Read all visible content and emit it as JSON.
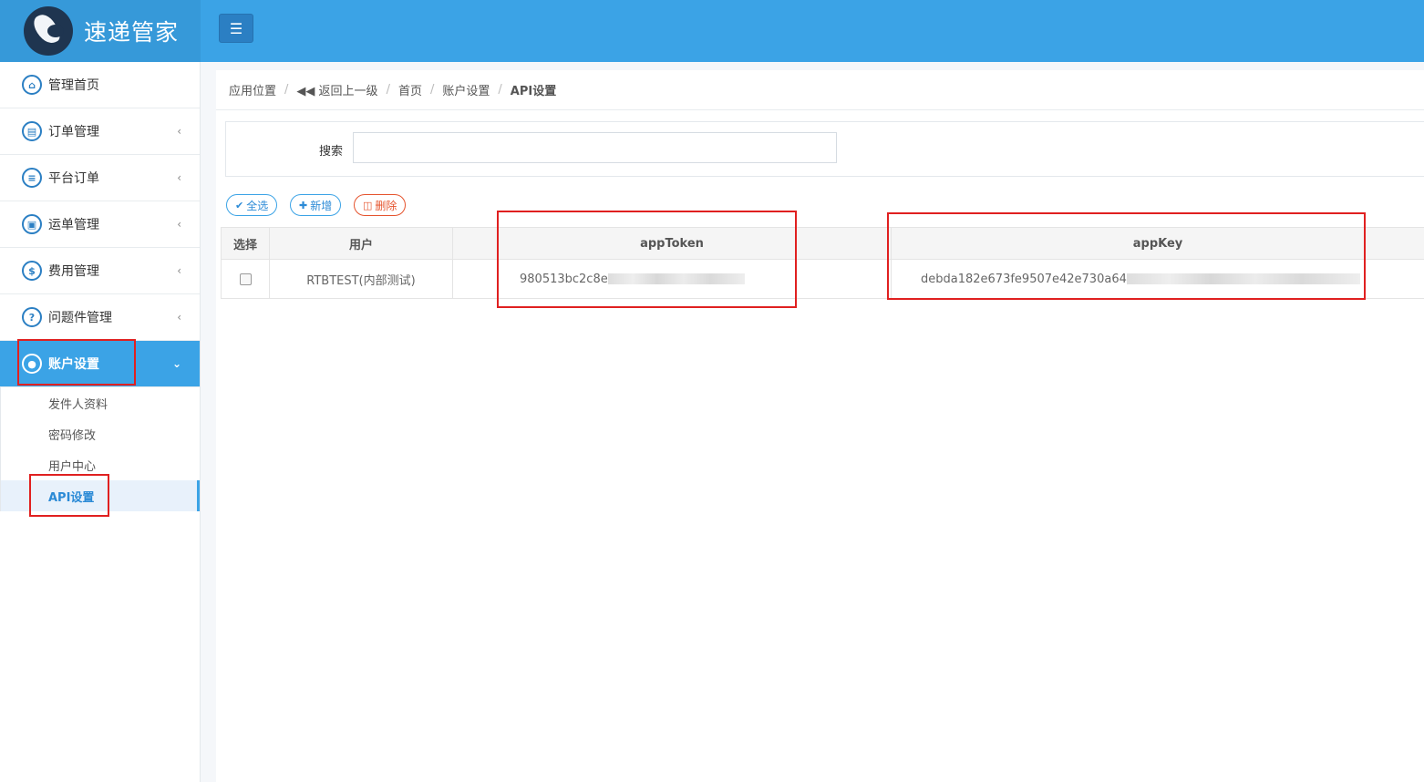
{
  "header": {
    "app_name": "速递管家",
    "menu_toggle_icon": "hamburger-icon"
  },
  "sidebar": {
    "items": [
      {
        "label": "管理首页",
        "icon": "home-icon",
        "has_children": false
      },
      {
        "label": "订单管理",
        "icon": "document-icon",
        "has_children": true
      },
      {
        "label": "平台订单",
        "icon": "list-icon",
        "has_children": true
      },
      {
        "label": "运单管理",
        "icon": "truck-icon",
        "has_children": true
      },
      {
        "label": "费用管理",
        "icon": "dollar-icon",
        "has_children": true
      },
      {
        "label": "问题件管理",
        "icon": "question-icon",
        "has_children": true
      },
      {
        "label": "账户设置",
        "icon": "user-icon",
        "has_children": true,
        "expanded": true,
        "active": true
      }
    ],
    "sub_items": [
      {
        "label": "发件人资料"
      },
      {
        "label": "密码修改"
      },
      {
        "label": "用户中心"
      },
      {
        "label": "API设置",
        "active": true
      }
    ]
  },
  "breadcrumb": {
    "items": [
      "应用位置",
      "返回上一级",
      "首页",
      "账户设置",
      "API设置"
    ]
  },
  "search": {
    "label": "搜索",
    "value": "",
    "placeholder": ""
  },
  "toolbar": {
    "select_all_label": "全选",
    "add_label": "新增",
    "delete_label": "删除"
  },
  "table": {
    "headers": [
      "选择",
      "用户",
      "appToken",
      "appKey"
    ],
    "rows": [
      {
        "checked": false,
        "user": "RTBTEST(内部测试)",
        "app_token": "980513bc2c8e",
        "app_key": "debda182e673fe9507e42e730a64"
      }
    ]
  },
  "colors": {
    "header_bg": "#3ba3e6",
    "accent": "#2b8ad6",
    "danger": "#e5532d",
    "annotation": "#e02020"
  }
}
